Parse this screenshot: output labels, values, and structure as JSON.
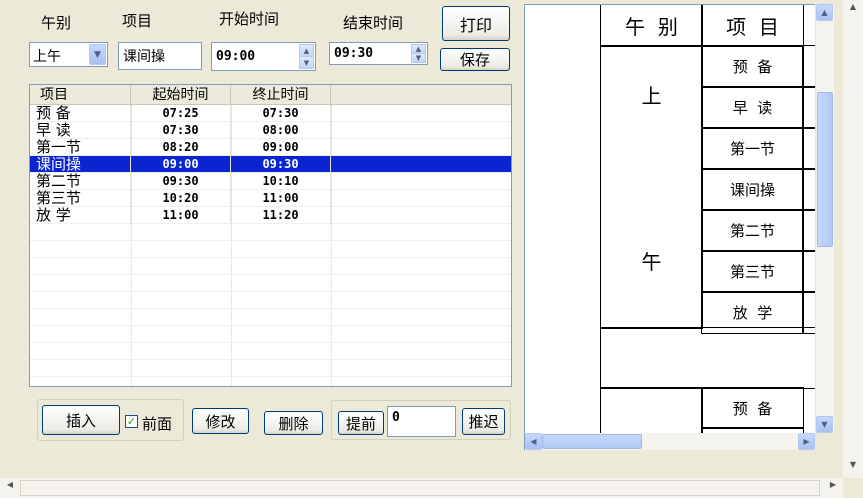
{
  "form": {
    "period_label": "午别",
    "item_label": "项目",
    "start_time_label": "开始时间",
    "end_time_label": "结束时间",
    "period_value": "上午",
    "item_value": "课间操",
    "start_time_value": "09:00",
    "end_time_value": "09:30",
    "print_button": "打印",
    "save_button": "保存"
  },
  "list": {
    "headers": [
      "项目",
      "起始时间",
      "终止时间"
    ],
    "rows": [
      {
        "item": "预 备",
        "start": "07:25",
        "end": "07:30"
      },
      {
        "item": "早 读",
        "start": "07:30",
        "end": "08:00"
      },
      {
        "item": "第一节",
        "start": "08:20",
        "end": "09:00"
      },
      {
        "item": "课间操",
        "start": "09:00",
        "end": "09:30"
      },
      {
        "item": "第二节",
        "start": "09:30",
        "end": "10:10"
      },
      {
        "item": "第三节",
        "start": "10:20",
        "end": "11:00"
      },
      {
        "item": "放 学",
        "start": "11:00",
        "end": "11:20"
      }
    ],
    "selected_index": 3
  },
  "actions": {
    "insert_button": "插入",
    "front_checkbox_label": "前面",
    "front_checked": true,
    "modify_button": "修改",
    "delete_button": "删除",
    "advance_button": "提前",
    "offset_value": "0",
    "delay_button": "推迟"
  },
  "preview": {
    "header_period": "午  别",
    "header_item": "项  目",
    "period_char_1": "上",
    "period_char_2": "午",
    "items": [
      "预  备",
      "早  读",
      "第一节",
      "课间操",
      "第二节",
      "第三节",
      "放  学"
    ],
    "next_item": "预  备"
  }
}
